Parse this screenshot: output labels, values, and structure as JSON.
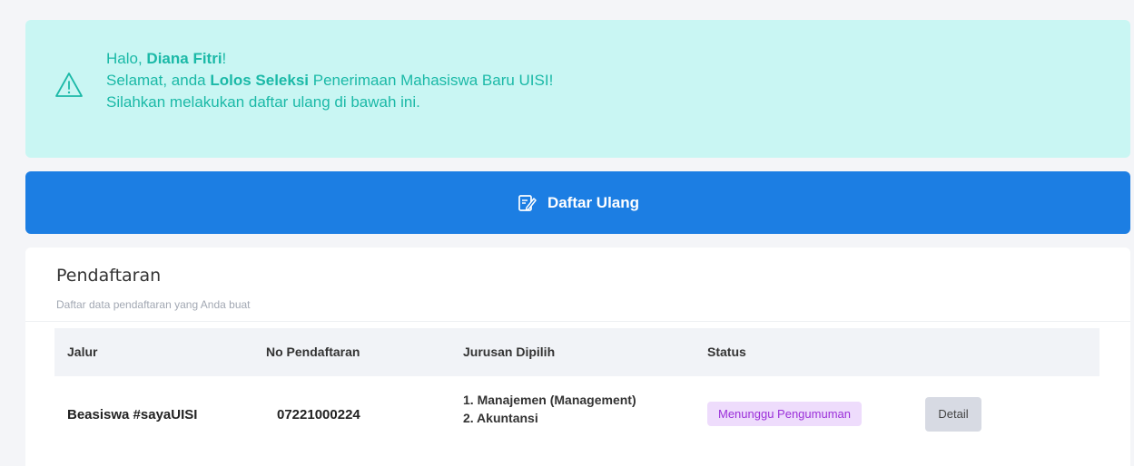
{
  "alert": {
    "greeting_prefix": "Halo, ",
    "name": "Diana Fitri",
    "greeting_suffix": "!",
    "line2_prefix": "Selamat, anda ",
    "line2_bold": "Lolos Seleksi",
    "line2_suffix": " Penerimaan Mahasiswa Baru UISI!",
    "line3": "Silahkan melakukan daftar ulang di bawah ini.",
    "icon": "warning-triangle-icon",
    "color": "#1bb9a7",
    "background": "#c9f6f3"
  },
  "re_register_button": {
    "label": "Daftar Ulang",
    "icon": "edit-note-icon",
    "color": "#1c7ee3"
  },
  "registration": {
    "title": "Pendaftaran",
    "subtitle": "Daftar data pendaftaran yang Anda buat",
    "columns": [
      "Jalur",
      "No Pendaftaran",
      "Jurusan Dipilih",
      "Status"
    ],
    "rows": [
      {
        "jalur": "Beasiswa #sayaUISI",
        "no_pendaftaran": "07221000224",
        "jurusan": [
          "1. Manajemen (Management)",
          "2. Akuntansi"
        ],
        "status": "Menunggu Pengumuman",
        "action": "Detail"
      }
    ]
  }
}
